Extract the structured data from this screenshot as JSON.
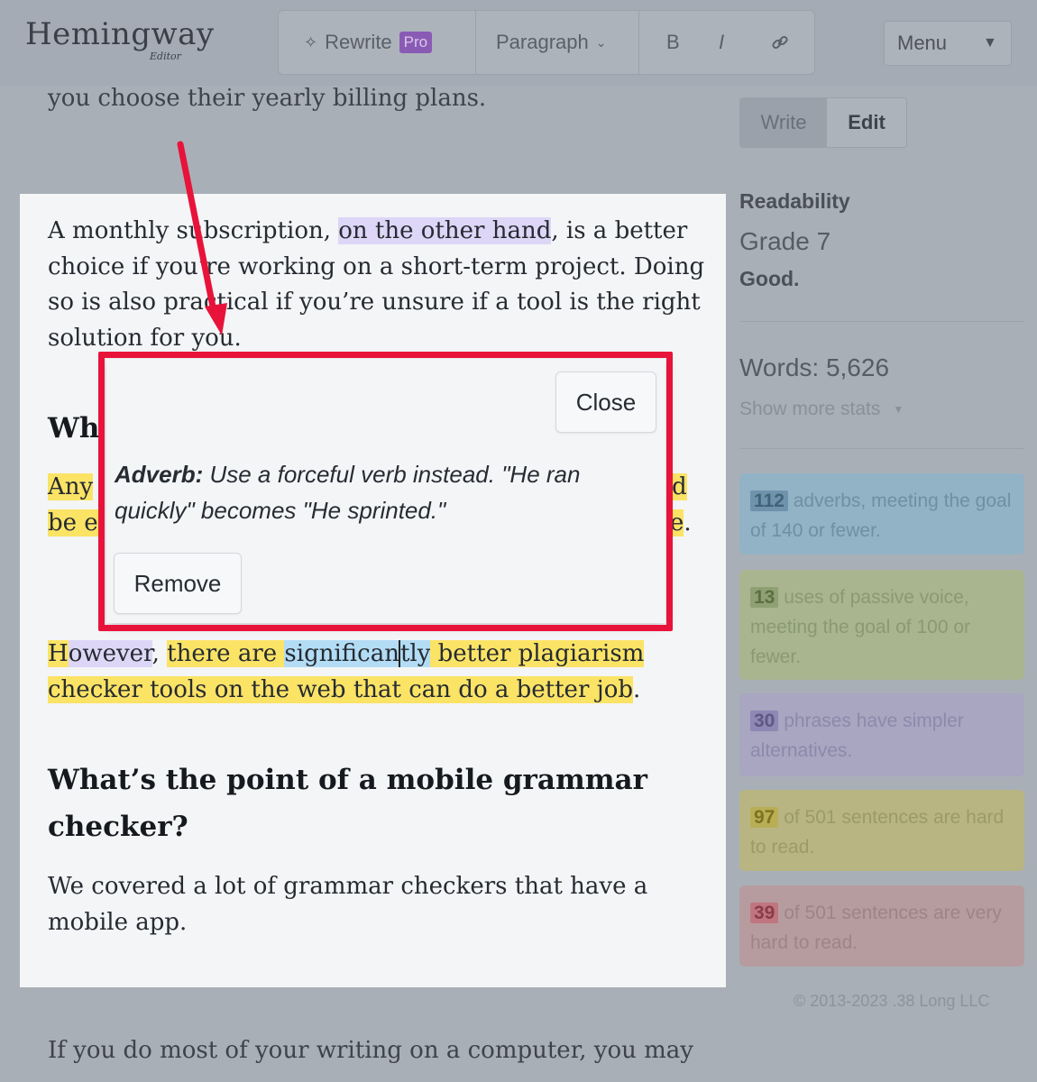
{
  "header": {
    "logo": "Hemingway",
    "logo_sub": "Editor",
    "rewrite_label": "Rewrite",
    "pro_badge": "Pro",
    "paragraph_label": "Paragraph",
    "bold_label": "B",
    "italic_label": "I",
    "menu_label": "Menu"
  },
  "background_text": {
    "top_line": "you choose their yearly billing plans.",
    "bottom_line": "If you do most of your writing on a computer, you may"
  },
  "sidebar": {
    "write_label": "Write",
    "edit_label": "Edit",
    "readability_label": "Readability",
    "grade": "Grade 7",
    "grade_verdict": "Good.",
    "words": "Words: 5,626",
    "show_more_stats": "Show more stats",
    "stats": [
      {
        "num": "112",
        "text": " adverbs, meeting the goal of 140 or fewer."
      },
      {
        "num": "13",
        "text": " uses of passive voice, meeting the goal of 100 or fewer."
      },
      {
        "num": "30",
        "text": " phrases have simpler alternatives."
      },
      {
        "num": "97",
        "text": " of 501 sentences are hard to read."
      },
      {
        "num": "39",
        "text": " of 501 sentences are very hard to read."
      }
    ],
    "copyright": "© 2013-2023 .38 Long LLC"
  },
  "content": {
    "p1_a": "A monthly subscription, ",
    "p1_hl": "on the other hand",
    "p1_b": ", is a better choice if you’re working on a short-term project. Doing so is also practical if you’re unsure if a tool is the right solution for you.",
    "h1_partial": "Wh",
    "p2_line1_start": "Any",
    "p2_line1_end": "d",
    "p2_line2_start": "be e",
    "p2_line2_end": "e",
    "p3_h": "H",
    "p3_owever": "owever",
    "p3_a": ", ",
    "p3_there": "there are ",
    "p3_signif": "significan",
    "p3_tly": "tly",
    "p3_rest": " better plagiarism checker tools on the web that can do a better job",
    "p3_end": ".",
    "h2": "What’s the point of a mobile grammar checker?",
    "p4": "We covered a lot of grammar checkers that have a mobile app."
  },
  "popup": {
    "close_label": "Close",
    "adverb_label": "Adverb:",
    "adverb_text": " Use a forceful verb instead. \"He ran quickly\" becomes \"He sprinted.\"",
    "remove_label": "Remove"
  },
  "colors": {
    "highlight_frame": "#e8133a",
    "arrow": "#e8133a",
    "adverb_blue": "#b3dcf5",
    "hard_yellow": "#fbe366",
    "simpler_purple": "#ddd6f7"
  }
}
